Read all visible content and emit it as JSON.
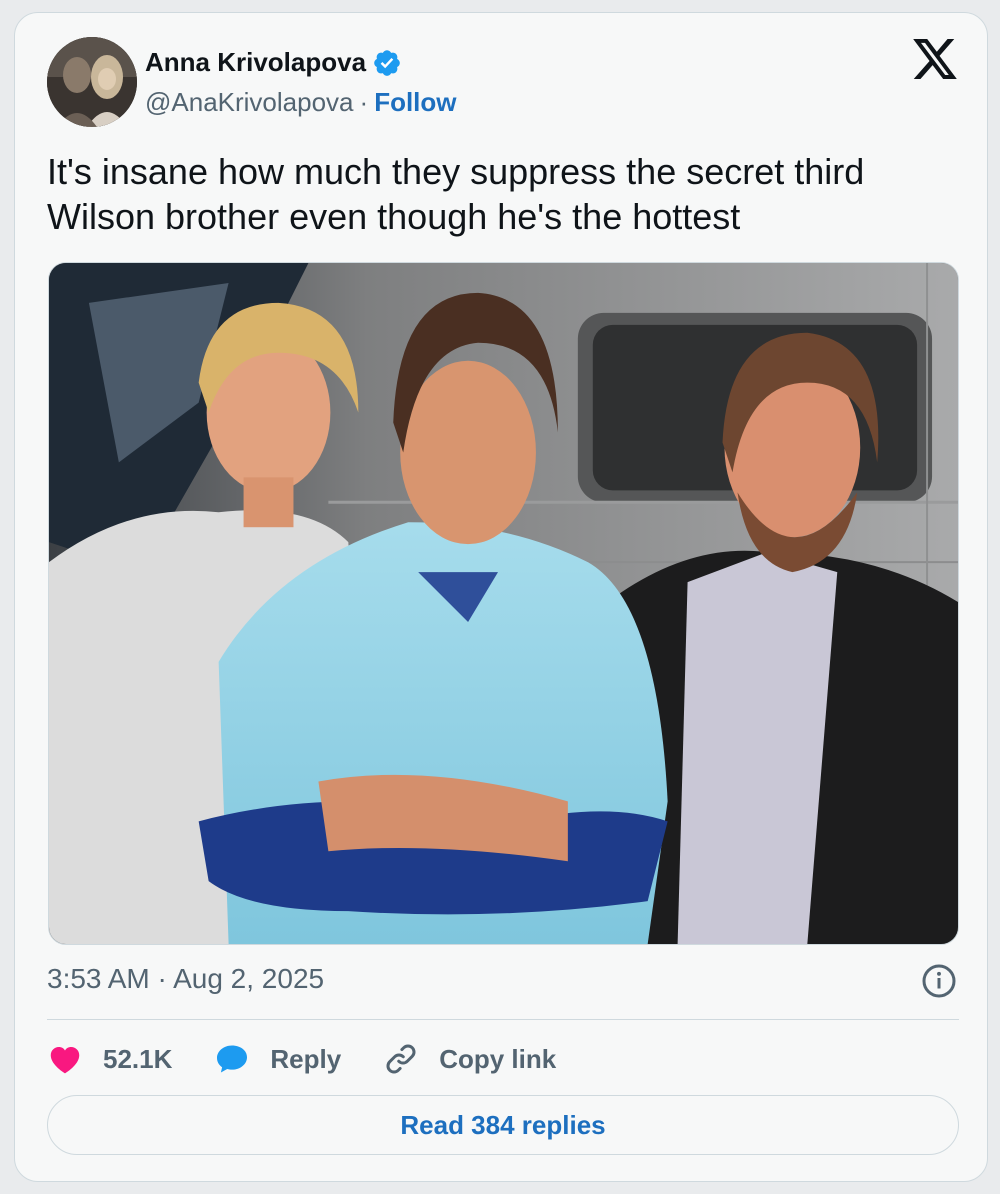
{
  "author": {
    "name": "Anna Krivolapova",
    "handle": "@AnaKrivolapova",
    "separator": "·",
    "follow_label": "Follow",
    "verified": true
  },
  "brand": {
    "icon": "x-logo-icon"
  },
  "tweet": {
    "text_line1": "It's insane how much they suppress the secret third",
    "text_line2": "Wilson brother even though he's the hottest",
    "media_alt": "photo-of-three-smiling-men"
  },
  "meta": {
    "time": "3:53 AM",
    "separator": "·",
    "date": "Aug 2, 2025"
  },
  "actions": {
    "like_count": "52.1K",
    "reply_label": "Reply",
    "copy_label": "Copy link"
  },
  "footer": {
    "read_replies_label": "Read 384 replies"
  },
  "colors": {
    "accent": "#1d6fbf",
    "heart": "#f91880",
    "reply_bubble": "#1d9bf0",
    "text_secondary": "#536471"
  }
}
